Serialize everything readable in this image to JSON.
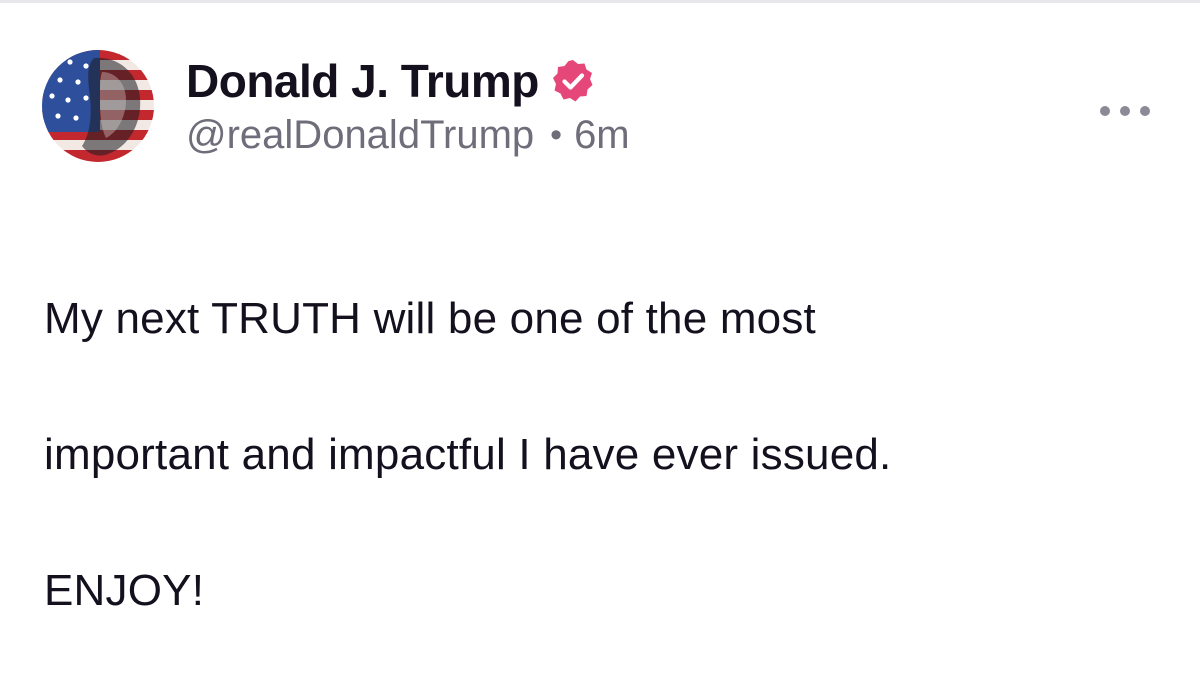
{
  "post": {
    "author": {
      "display_name": "Donald J. Trump",
      "handle": "@realDonaldTrump",
      "verified_icon": "verified-badge-icon",
      "avatar_icon": "avatar-image"
    },
    "meta": {
      "separator": "•",
      "time_ago": "6m"
    },
    "more_icon": "more-options-icon",
    "content_lines": [
      "My next TRUTH will be one of the most",
      "important and impactful I have ever issued.",
      "ENJOY!"
    ]
  },
  "colors": {
    "text_primary": "#14101e",
    "text_secondary": "#6f6d7a",
    "verified_badge": "#e64779",
    "divider": "#e8e8ec"
  }
}
